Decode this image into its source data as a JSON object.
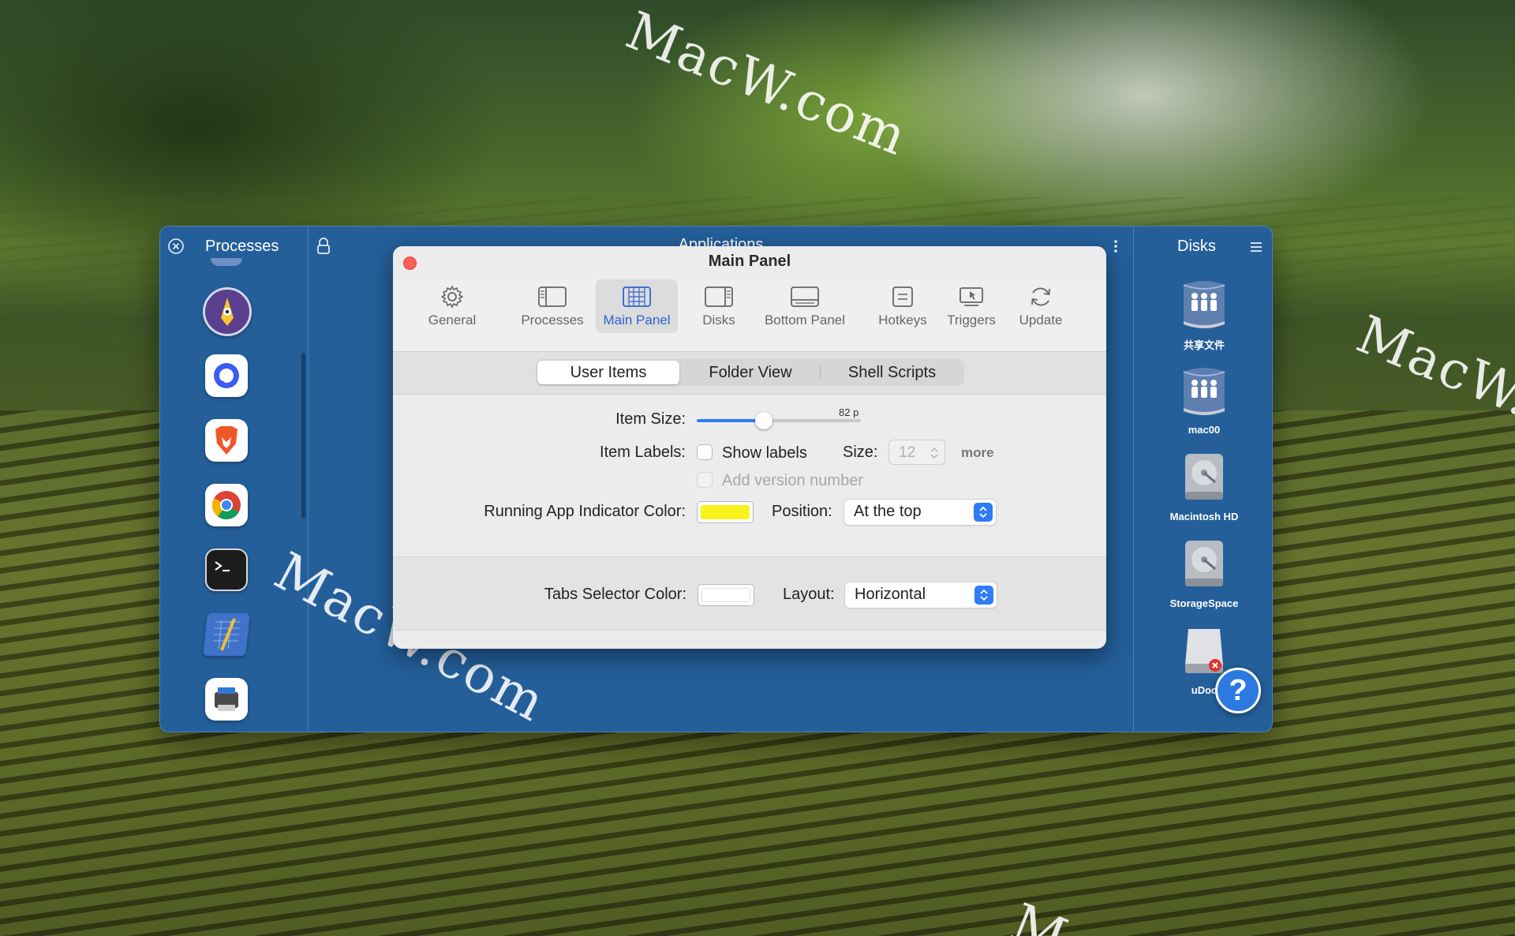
{
  "watermarks": [
    "MacW.com",
    "MacW.com",
    "MacW.com",
    "M"
  ],
  "processes_panel": {
    "title": "Processes",
    "icons": [
      {
        "name": "pencil-mascot-app-icon",
        "color": "#5b3f8f"
      },
      {
        "name": "blue-chat-app-icon",
        "color": "#ffffff"
      },
      {
        "name": "brave-browser-icon",
        "color": "#ffffff"
      },
      {
        "name": "chrome-browser-icon",
        "color": "#ffffff"
      },
      {
        "name": "terminal-app-icon",
        "color": "#1c1c1c"
      },
      {
        "name": "blueprint-app-icon",
        "color": "#3f72c8"
      },
      {
        "name": "scanner-app-icon",
        "color": "#ffffff"
      }
    ]
  },
  "applications_panel": {
    "title": "Applications"
  },
  "disks_panel": {
    "title": "Disks",
    "items": [
      {
        "label": "共享文件",
        "icon": "network-share-icon"
      },
      {
        "label": "mac00",
        "icon": "network-share-icon"
      },
      {
        "label": "Macintosh HD",
        "icon": "hard-disk-icon"
      },
      {
        "label": "StorageSpace",
        "icon": "hard-disk-icon"
      },
      {
        "label": "uDoc",
        "icon": "external-drive-icon"
      }
    ]
  },
  "help_button": {
    "label": "?"
  },
  "dialog": {
    "title": "Main Panel",
    "toolbar": [
      {
        "label": "General",
        "icon": "gear-icon",
        "active": false
      },
      {
        "label": "Processes",
        "icon": "sidebar-left-icon",
        "active": false
      },
      {
        "label": "Main Panel",
        "icon": "grid-panel-icon",
        "active": true
      },
      {
        "label": "Disks",
        "icon": "sidebar-right-icon",
        "active": false
      },
      {
        "label": "Bottom Panel",
        "icon": "bottom-panel-icon",
        "active": false
      },
      {
        "label": "Hotkeys",
        "icon": "keyboard-key-icon",
        "active": false
      },
      {
        "label": "Triggers",
        "icon": "cursor-screen-icon",
        "active": false
      },
      {
        "label": "Update",
        "icon": "refresh-icon",
        "active": false
      }
    ],
    "tabs": [
      "User Items",
      "Folder View",
      "Shell Scripts"
    ],
    "selected_tab": "User Items",
    "item_size": {
      "label": "Item Size:",
      "value_text": "82 p",
      "fraction": 0.41
    },
    "item_labels": {
      "label": "Item Labels:",
      "show_labels": "Show labels",
      "show_labels_checked": false,
      "add_version": "Add version number",
      "add_version_checked": false,
      "size_label": "Size:",
      "size_value": "12",
      "more_label": "more"
    },
    "indicator": {
      "label": "Running App Indicator Color:",
      "color": "#f8f31a",
      "position_label": "Position:",
      "position_value": "At the top"
    },
    "tabs_selector": {
      "label": "Tabs Selector Color:",
      "color": "#ffffff",
      "layout_label": "Layout:",
      "layout_value": "Horizontal"
    }
  }
}
